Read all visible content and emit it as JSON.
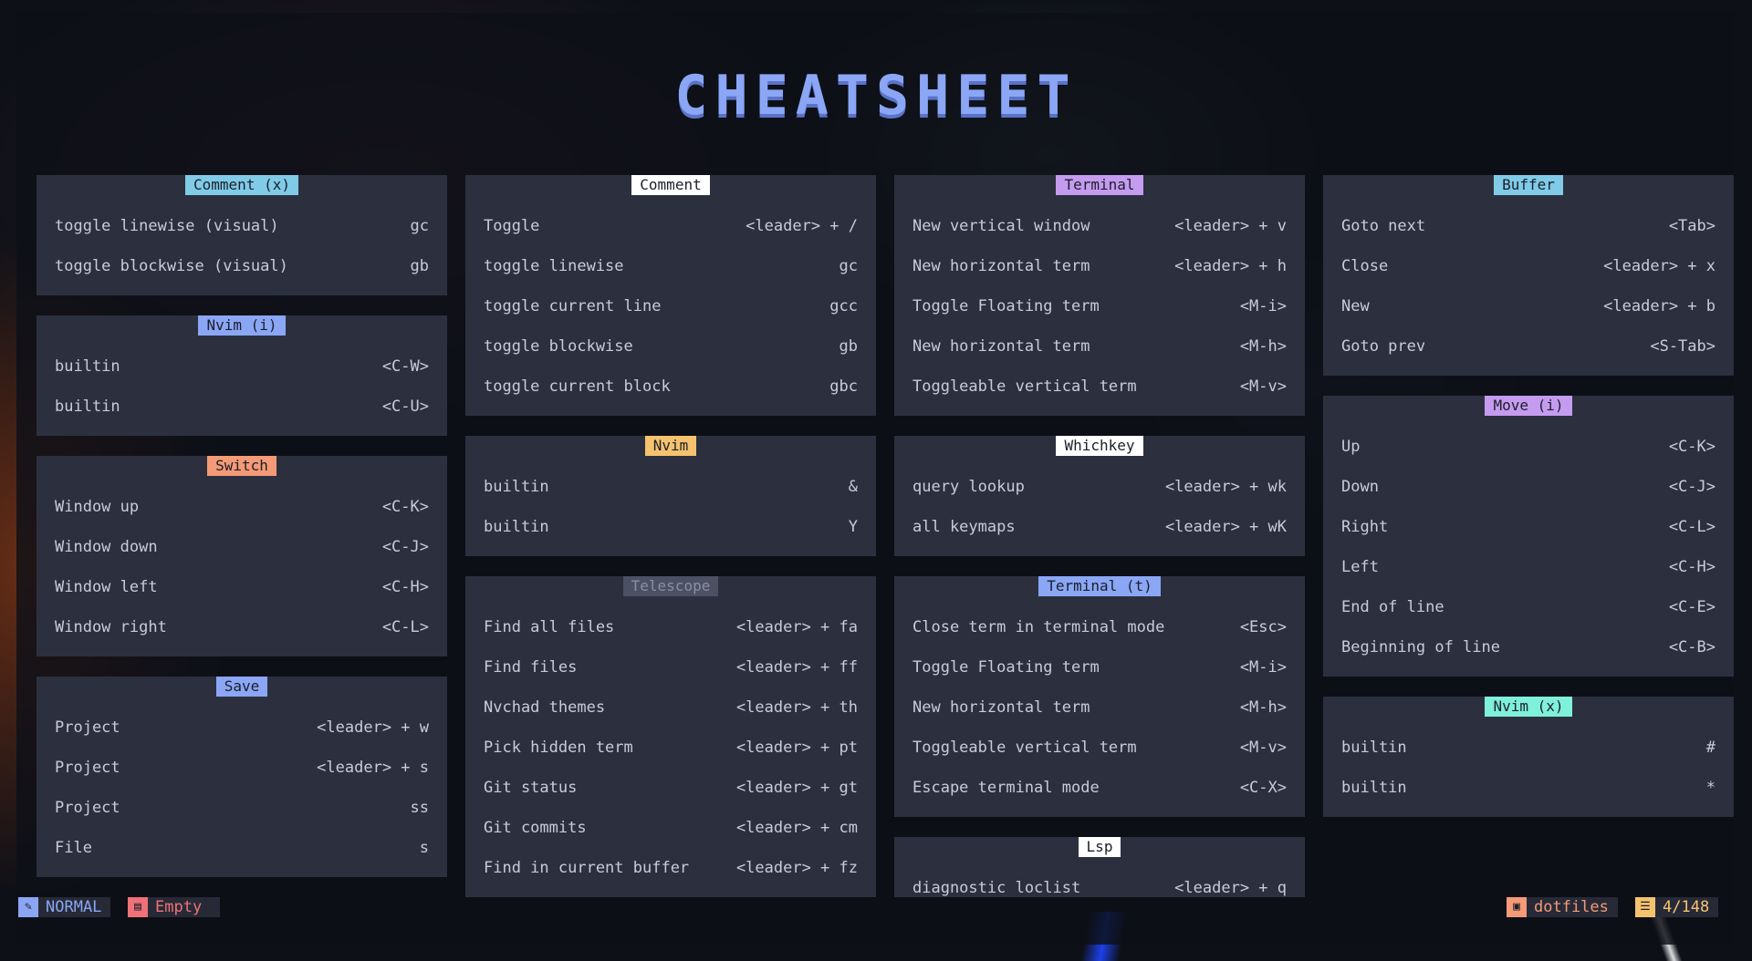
{
  "title": "CHEATSHEET",
  "colors": {
    "blue": "#8aa6f5",
    "cyan": "#7fcbe8",
    "white": "#ffffff",
    "violet": "#c59bf0",
    "orange": "#f49a77",
    "yellow": "#f5c36e",
    "grey": "#4b5063",
    "teal": "#7ff0d9",
    "red": "#f07178"
  },
  "cards": [
    {
      "id": "comment-x",
      "title": "Comment (x)",
      "rows": [
        {
          "desc": "toggle linewise (visual)",
          "key": "gc"
        },
        {
          "desc": "toggle blockwise (visual)",
          "key": "gb"
        }
      ]
    },
    {
      "id": "nvim-i",
      "title": "Nvim (i)",
      "rows": [
        {
          "desc": "builtin",
          "key": "<C-W>"
        },
        {
          "desc": "builtin",
          "key": "<C-U>"
        }
      ]
    },
    {
      "id": "switch",
      "title": "Switch",
      "rows": [
        {
          "desc": "Window up",
          "key": "<C-K>"
        },
        {
          "desc": "Window down",
          "key": "<C-J>"
        },
        {
          "desc": "Window left",
          "key": "<C-H>"
        },
        {
          "desc": "Window right",
          "key": "<C-L>"
        }
      ]
    },
    {
      "id": "save",
      "title": "Save",
      "rows": [
        {
          "desc": "Project",
          "key": "<leader> + w"
        },
        {
          "desc": "Project",
          "key": "<leader> + s"
        },
        {
          "desc": "Project",
          "key": "ss"
        },
        {
          "desc": "File",
          "key": "s"
        }
      ]
    },
    {
      "id": "comment",
      "title": "Comment",
      "rows": [
        {
          "desc": "Toggle",
          "key": "<leader> + /"
        },
        {
          "desc": "toggle linewise",
          "key": "gc"
        },
        {
          "desc": "toggle current line",
          "key": "gcc"
        },
        {
          "desc": "toggle blockwise",
          "key": "gb"
        },
        {
          "desc": "toggle current block",
          "key": "gbc"
        }
      ]
    },
    {
      "id": "nvim",
      "title": "Nvim",
      "rows": [
        {
          "desc": "builtin",
          "key": "&"
        },
        {
          "desc": "builtin",
          "key": "Y"
        }
      ]
    },
    {
      "id": "telescope",
      "title": "Telescope",
      "rows": [
        {
          "desc": "Find all files",
          "key": "<leader> + fa"
        },
        {
          "desc": "Find files",
          "key": "<leader> + ff"
        },
        {
          "desc": "Nvchad themes",
          "key": "<leader> + th"
        },
        {
          "desc": "Pick hidden term",
          "key": "<leader> + pt"
        },
        {
          "desc": "Git status",
          "key": "<leader> + gt"
        },
        {
          "desc": "Git commits",
          "key": "<leader> + cm"
        },
        {
          "desc": "Find in current buffer",
          "key": "<leader> + fz"
        }
      ]
    },
    {
      "id": "terminal",
      "title": "Terminal",
      "rows": [
        {
          "desc": "New vertical window",
          "key": "<leader> + v"
        },
        {
          "desc": "New horizontal term",
          "key": "<leader> + h"
        },
        {
          "desc": "Toggle Floating term",
          "key": "<M-i>"
        },
        {
          "desc": "New horizontal term",
          "key": "<M-h>"
        },
        {
          "desc": "Toggleable vertical term",
          "key": "<M-v>"
        }
      ]
    },
    {
      "id": "whichkey",
      "title": "Whichkey",
      "rows": [
        {
          "desc": "query lookup",
          "key": "<leader> + wk"
        },
        {
          "desc": "all keymaps",
          "key": "<leader> + wK"
        }
      ]
    },
    {
      "id": "terminal-t",
      "title": "Terminal (t)",
      "rows": [
        {
          "desc": "Close term in terminal mode",
          "key": "<Esc>"
        },
        {
          "desc": "Toggle Floating term",
          "key": "<M-i>"
        },
        {
          "desc": "New horizontal term",
          "key": "<M-h>"
        },
        {
          "desc": "Toggleable vertical term",
          "key": "<M-v>"
        },
        {
          "desc": "Escape terminal mode",
          "key": "<C-X>"
        }
      ]
    },
    {
      "id": "lsp",
      "title": "Lsp",
      "rows": [
        {
          "desc": "diagnostic loclist",
          "key": "<leader> + q"
        }
      ]
    },
    {
      "id": "buffer",
      "title": "Buffer",
      "rows": [
        {
          "desc": "Goto next",
          "key": "<Tab>"
        },
        {
          "desc": "Close",
          "key": "<leader> + x"
        },
        {
          "desc": "New",
          "key": "<leader> + b"
        },
        {
          "desc": "Goto prev",
          "key": "<S-Tab>"
        }
      ]
    },
    {
      "id": "move-i",
      "title": "Move (i)",
      "rows": [
        {
          "desc": "Up",
          "key": "<C-K>"
        },
        {
          "desc": "Down",
          "key": "<C-J>"
        },
        {
          "desc": "Right",
          "key": "<C-L>"
        },
        {
          "desc": "Left",
          "key": "<C-H>"
        },
        {
          "desc": "End of line",
          "key": "<C-E>"
        },
        {
          "desc": "Beginning of line",
          "key": "<C-B>"
        }
      ]
    },
    {
      "id": "nvim-x",
      "title": "Nvim (x)",
      "rows": [
        {
          "desc": "builtin",
          "key": "#"
        },
        {
          "desc": "builtin",
          "key": "*"
        }
      ]
    }
  ],
  "statusbar": {
    "mode": "NORMAL",
    "mode_icon": "vim-icon",
    "file": "Empty",
    "file_icon": "file-icon",
    "cwd": "dotfiles",
    "cwd_icon": "folder-icon",
    "position": "4/148",
    "position_icon": "lines-icon"
  }
}
